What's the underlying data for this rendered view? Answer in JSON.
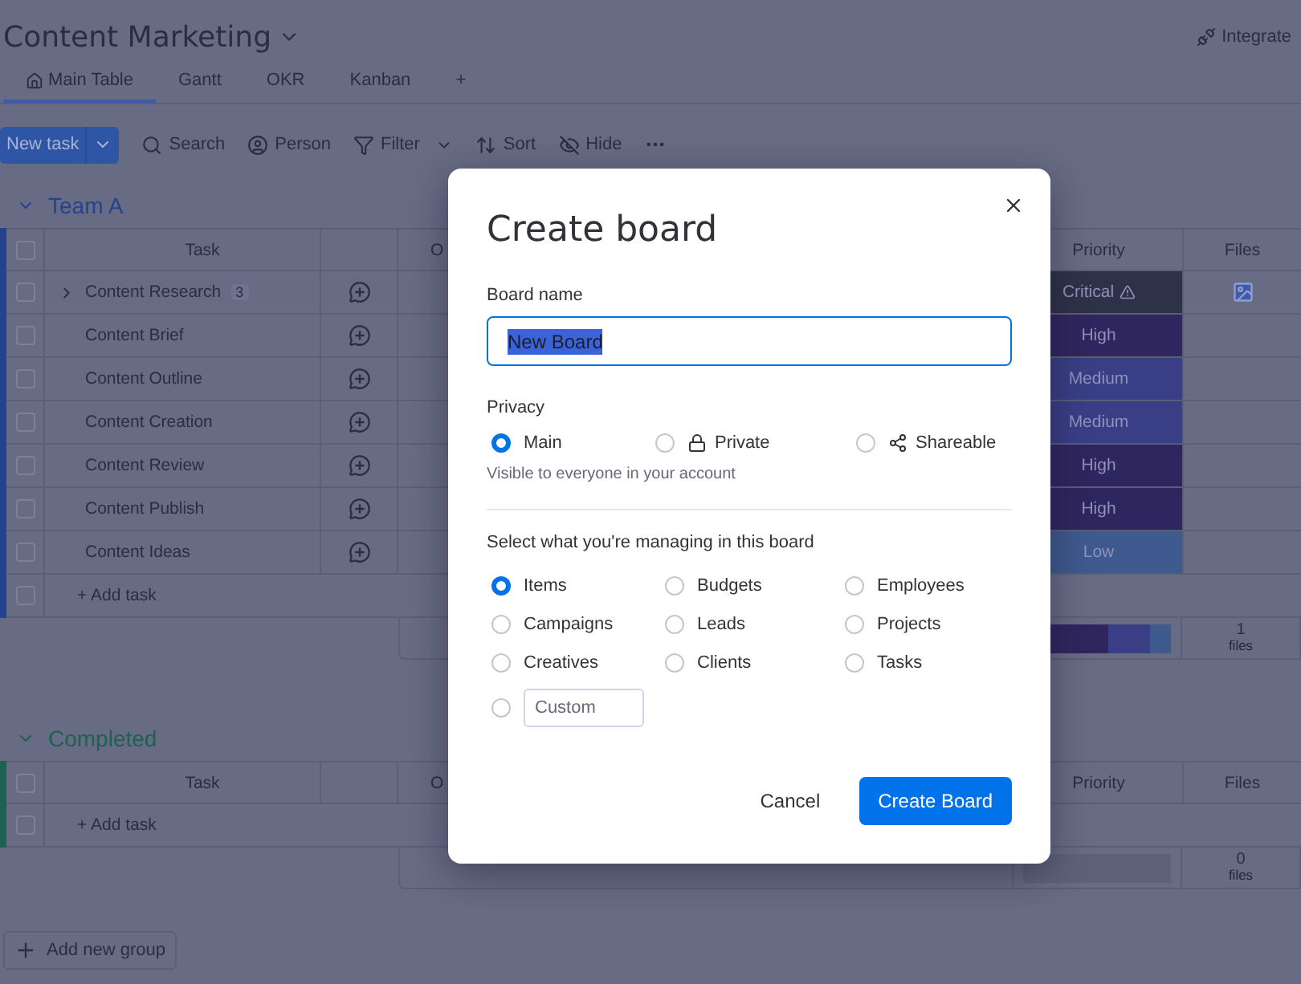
{
  "board": {
    "title": "Content Marketing",
    "integrate": "Integrate",
    "tabs": [
      {
        "label": "Main Table",
        "selected": true,
        "home": true
      },
      {
        "label": "Gantt",
        "selected": false,
        "home": false
      },
      {
        "label": "OKR",
        "selected": false,
        "home": false
      },
      {
        "label": "Kanban",
        "selected": false,
        "home": false
      }
    ],
    "add_tab": "+"
  },
  "toolbar": {
    "new_task": "New task",
    "items": [
      {
        "label": "Search",
        "kind": "search",
        "dropdown": false
      },
      {
        "label": "Person",
        "kind": "person",
        "dropdown": false
      },
      {
        "label": "Filter",
        "kind": "filter",
        "dropdown": true
      },
      {
        "label": "Sort",
        "kind": "sort",
        "dropdown": false
      },
      {
        "label": "Hide",
        "kind": "hide",
        "dropdown": false
      }
    ]
  },
  "groups": [
    {
      "name": "Team A",
      "color": "#24438f",
      "header_checked": false,
      "add_task_checked": false,
      "columns": [
        "Task",
        "O",
        "Priority",
        "Files"
      ],
      "add_task": "+ Add task",
      "summary": {
        "files_count": "1",
        "files_label": "files"
      },
      "rows": [
        {
          "task": "Content Research",
          "checked": false,
          "expandable": true,
          "subitems": "3",
          "priority": "Critical",
          "critical": true,
          "color": "#2e3249",
          "has_file": true
        },
        {
          "task": "Content Brief",
          "checked": false,
          "expandable": false,
          "priority": "High",
          "critical": false,
          "color": "#30265f",
          "has_file": false
        },
        {
          "task": "Content Outline",
          "checked": false,
          "expandable": false,
          "priority": "Medium",
          "critical": false,
          "color": "#3a3e85",
          "has_file": false
        },
        {
          "task": "Content Creation",
          "checked": false,
          "expandable": false,
          "priority": "Medium",
          "critical": false,
          "color": "#3a3e85",
          "has_file": false
        },
        {
          "task": "Content Review",
          "checked": false,
          "expandable": false,
          "priority": "High",
          "critical": false,
          "color": "#30265f",
          "has_file": false
        },
        {
          "task": "Content Publish",
          "checked": false,
          "expandable": false,
          "priority": "High",
          "critical": false,
          "color": "#30265f",
          "has_file": false
        },
        {
          "task": "Content Ideas",
          "checked": false,
          "expandable": false,
          "priority": "Low",
          "critical": false,
          "color": "#3e5a8f",
          "has_file": false
        }
      ]
    },
    {
      "name": "Completed",
      "color": "#1e6150",
      "header_checked": false,
      "add_task_checked": false,
      "columns": [
        "Task",
        "O",
        "Priority",
        "Files"
      ],
      "add_task": "+ Add task",
      "summary": {
        "files_count": "0",
        "files_label": "files"
      }
    }
  ],
  "add_group": "Add new group",
  "dialog": {
    "title": "Create board",
    "name_label": "Board name",
    "name_value": "New Board",
    "privacy_label": "Privacy",
    "privacy_options": [
      {
        "label": "Main",
        "selected": true,
        "kind": "plain"
      },
      {
        "label": "Private",
        "selected": false,
        "kind": "lock"
      },
      {
        "label": "Shareable",
        "selected": false,
        "kind": "share"
      }
    ],
    "privacy_note": "Visible to everyone in your account",
    "managing_label": "Select what you're managing in this board",
    "managing_options": [
      {
        "label": "Items",
        "selected": true
      },
      {
        "label": "Budgets",
        "selected": false
      },
      {
        "label": "Employees",
        "selected": false
      },
      {
        "label": "Campaigns",
        "selected": false
      },
      {
        "label": "Leads",
        "selected": false
      },
      {
        "label": "Projects",
        "selected": false
      },
      {
        "label": "Creatives",
        "selected": false
      },
      {
        "label": "Clients",
        "selected": false
      },
      {
        "label": "Tasks",
        "selected": false
      }
    ],
    "custom_placeholder": "Custom",
    "custom_selected": false,
    "cancel": "Cancel",
    "create": "Create Board"
  }
}
